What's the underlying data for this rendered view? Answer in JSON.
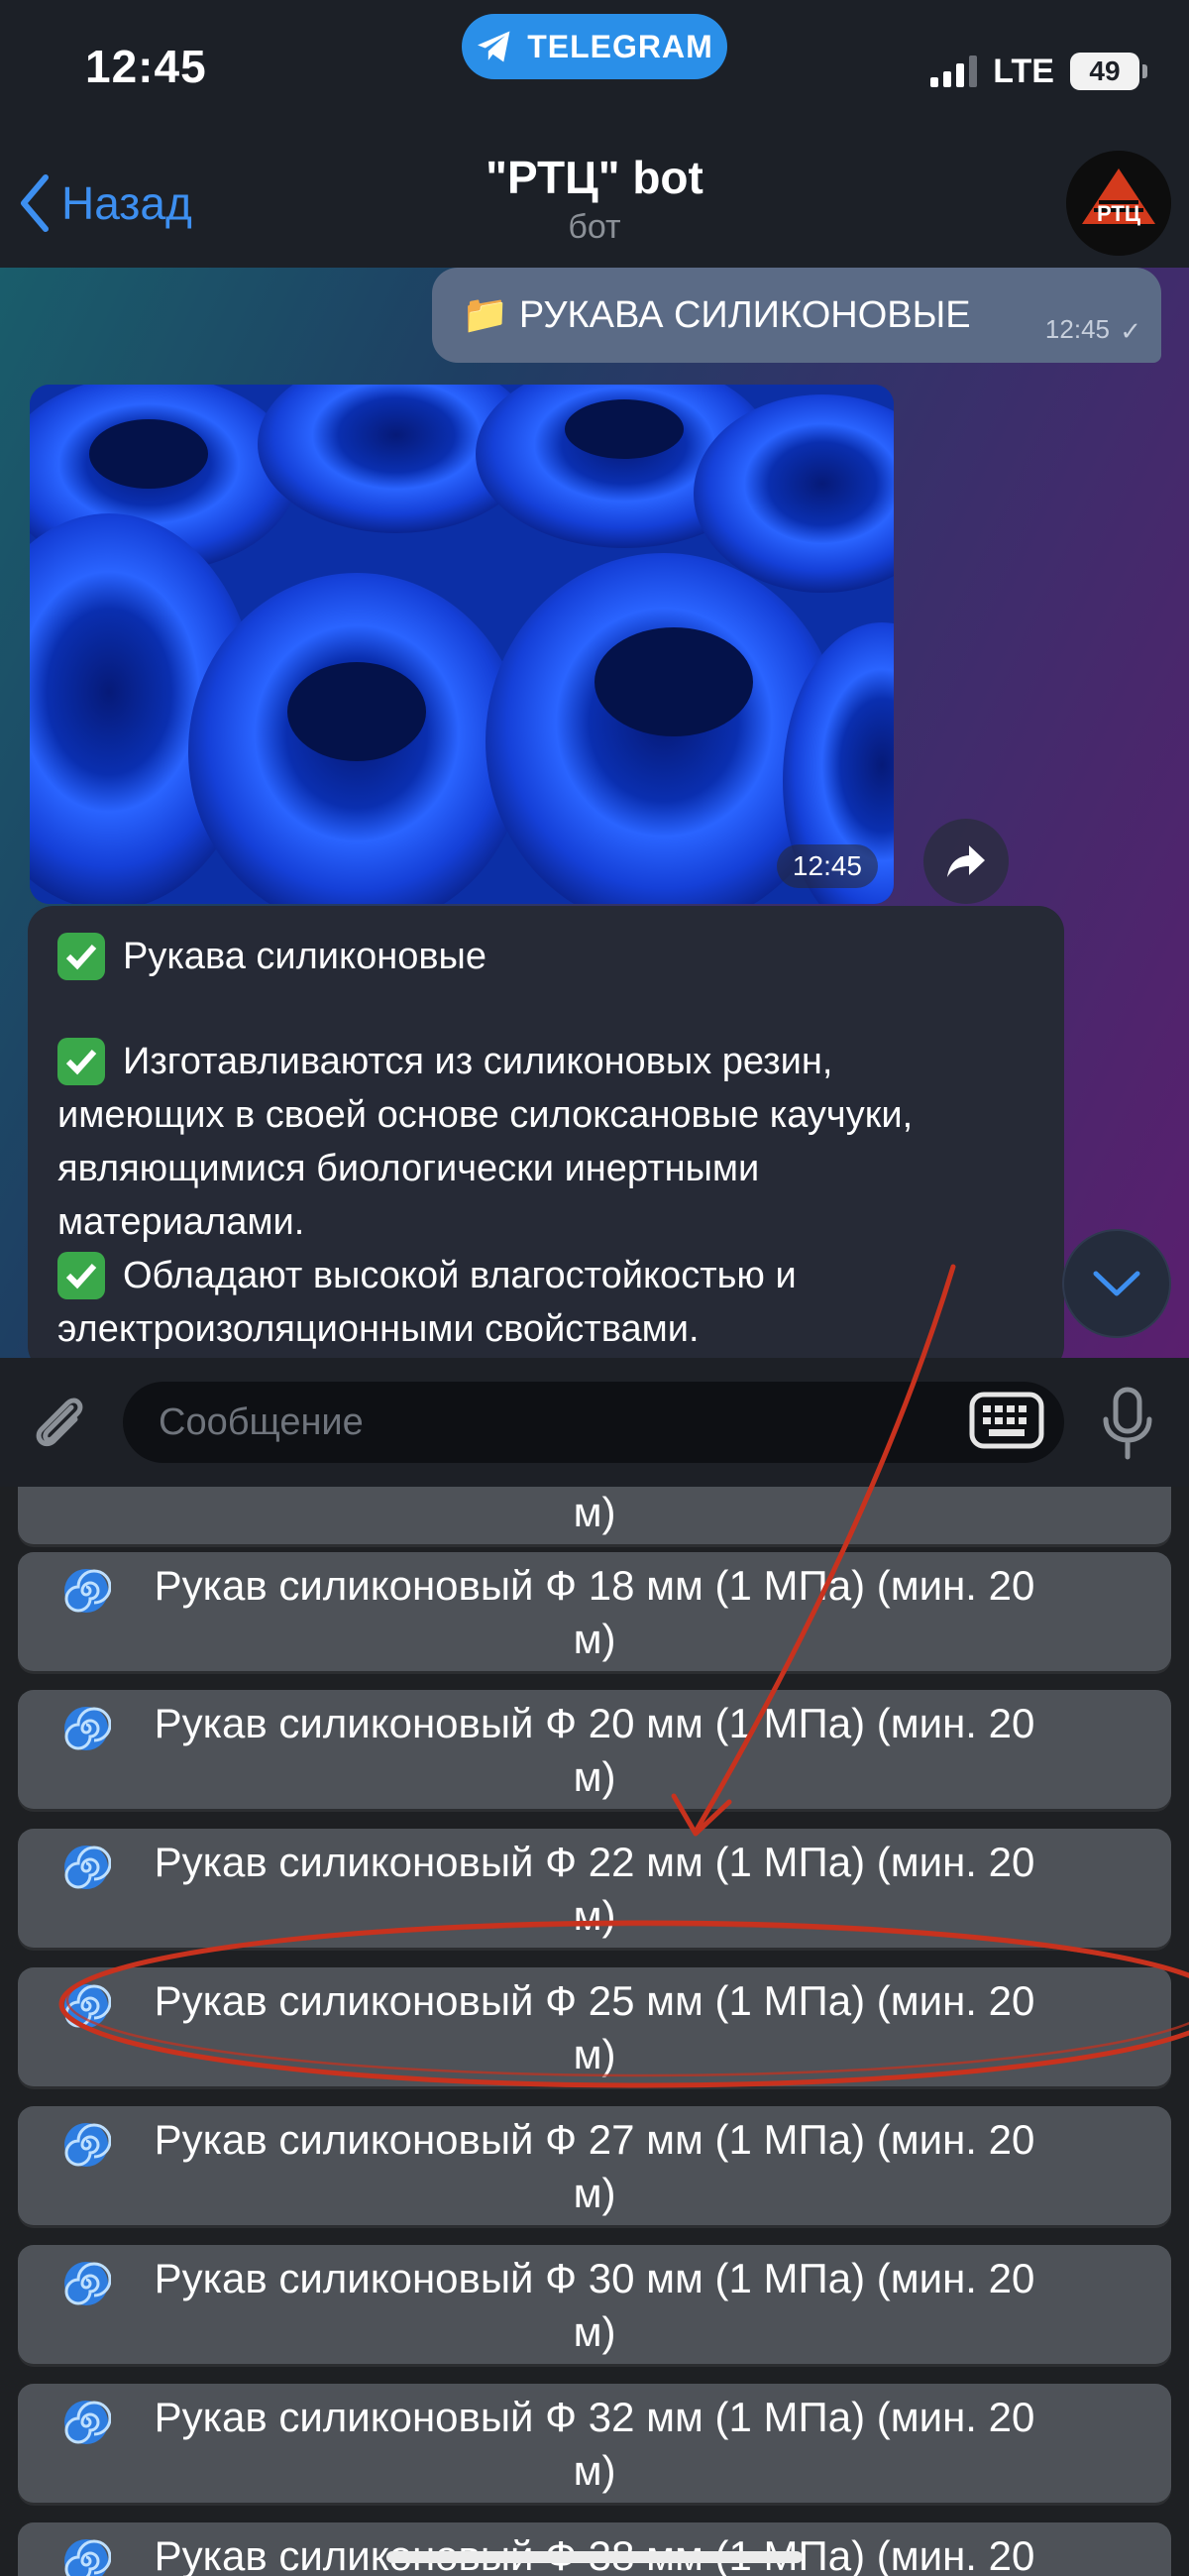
{
  "status_bar": {
    "time": "12:45",
    "pill_label": "TELEGRAM",
    "network": "LTE",
    "battery": "49"
  },
  "header": {
    "back_label": "Назад",
    "title": "\"РТЦ\" bot",
    "subtitle": "бот",
    "avatar_text": "РТЦ"
  },
  "outgoing_message": {
    "text": "📁 РУКАВА СИЛИКОНОВЫЕ",
    "time": "12:45"
  },
  "photo_message": {
    "time": "12:45"
  },
  "text_message": {
    "line1": "Рукава силиконовые",
    "line2": "Изготавливаются из силиконовых резин,",
    "line3": "имеющих в своей основе силоксановые каучуки,",
    "line4": "являющимися биологически инертными",
    "line5": "материалами.",
    "line6": "Обладают высокой влагостойкостью и",
    "line7": "электроизоляционными свойствами."
  },
  "input": {
    "placeholder": "Сообщение"
  },
  "keyboard_buttons": [
    {
      "line1": "",
      "line2": "м)"
    },
    {
      "line1": "Рукав силиконовый Ф 18 мм (1 МПа) (мин. 20",
      "line2": "м)"
    },
    {
      "line1": "Рукав силиконовый Ф 20 мм (1 МПа) (мин. 20",
      "line2": "м)"
    },
    {
      "line1": "Рукав силиконовый Ф 22 мм (1 МПа) (мин. 20",
      "line2": "м)"
    },
    {
      "line1": "Рукав силиконовый Ф 25 мм (1 МПа) (мин. 20",
      "line2": "м)"
    },
    {
      "line1": "Рукав силиконовый Ф 27 мм (1 МПа) (мин. 20",
      "line2": "м)"
    },
    {
      "line1": "Рукав силиконовый Ф 30 мм (1 МПа) (мин. 20",
      "line2": "м)"
    },
    {
      "line1": "Рукав силиконовый Ф 32 мм (1 МПа) (мин. 20",
      "line2": "м)"
    },
    {
      "line1": "Рукав силиконовый Ф 38 мм (1 МПа) (мин. 20",
      "line2": ""
    }
  ],
  "colors": {
    "accent": "#3d8ff0",
    "annotation": "#c8321e",
    "button": "#4e5258"
  }
}
